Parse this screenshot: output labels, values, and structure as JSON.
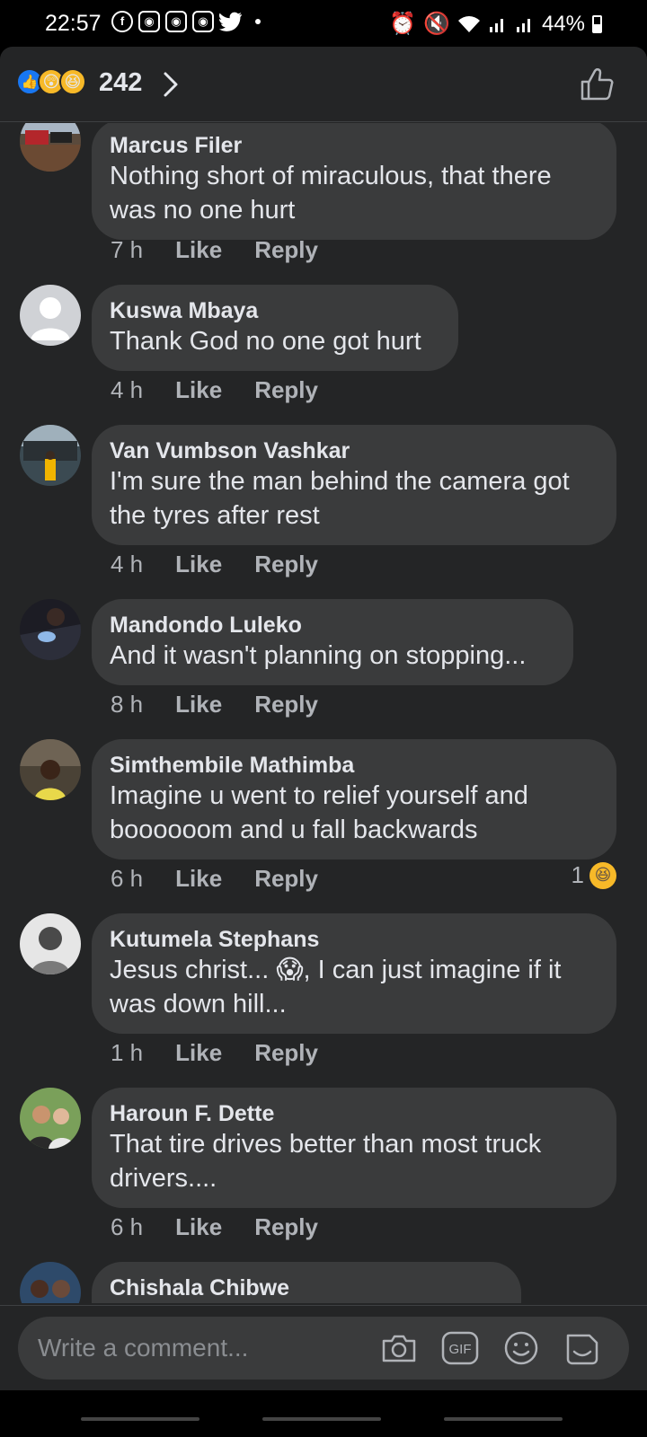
{
  "status_bar": {
    "time": "22:57",
    "battery": "44%",
    "app_icons": [
      "facebook-icon",
      "app-icon",
      "app-icon",
      "app-icon",
      "twitter-icon"
    ]
  },
  "header": {
    "reaction_count": "242",
    "reactions": [
      "like",
      "wow",
      "haha"
    ]
  },
  "comments": [
    {
      "author": "Marcus Filer",
      "lines": [
        "Nothing short of miraculous, that there",
        "was no one hurt"
      ],
      "time": "7 h",
      "like": "Like",
      "reply": "Reply"
    },
    {
      "author": "Kuswa Mbaya",
      "lines": [
        "Thank God no one got hurt"
      ],
      "time": "4 h",
      "like": "Like",
      "reply": "Reply"
    },
    {
      "author": "Van Vumbson Vashkar",
      "lines": [
        "I'm sure the man behind the camera got",
        "the tyres after rest"
      ],
      "time": "4 h",
      "like": "Like",
      "reply": "Reply"
    },
    {
      "author": "Mandondo Luleko",
      "lines": [
        "And it wasn't planning on stopping..."
      ],
      "time": "8 h",
      "like": "Like",
      "reply": "Reply"
    },
    {
      "author": "Simthembile Mathimba",
      "lines": [
        "Imagine u went to relief yourself and",
        "boooooom and u fall backwards"
      ],
      "time": "6 h",
      "like": "Like",
      "reply": "Reply",
      "reaction_count": "1"
    },
    {
      "author": "Kutumela Stephans",
      "lines": [
        "Jesus christ... 😱, I can just imagine if it",
        "was down hill..."
      ],
      "time": "1 h",
      "like": "Like",
      "reply": "Reply"
    },
    {
      "author": "Haroun F. Dette",
      "lines": [
        "That tire drives better than most truck",
        "drivers...."
      ],
      "time": "6 h",
      "like": "Like",
      "reply": "Reply"
    },
    {
      "author": "Chishala Chibwe",
      "lines": [],
      "time": "",
      "like": "",
      "reply": ""
    }
  ],
  "composer": {
    "placeholder": "Write a comment...",
    "gif_label": "GIF"
  },
  "colors": {
    "background": "#242526",
    "bubble": "#3a3b3c",
    "like_blue": "#1877f2",
    "emoji_yellow": "#f7b928"
  }
}
